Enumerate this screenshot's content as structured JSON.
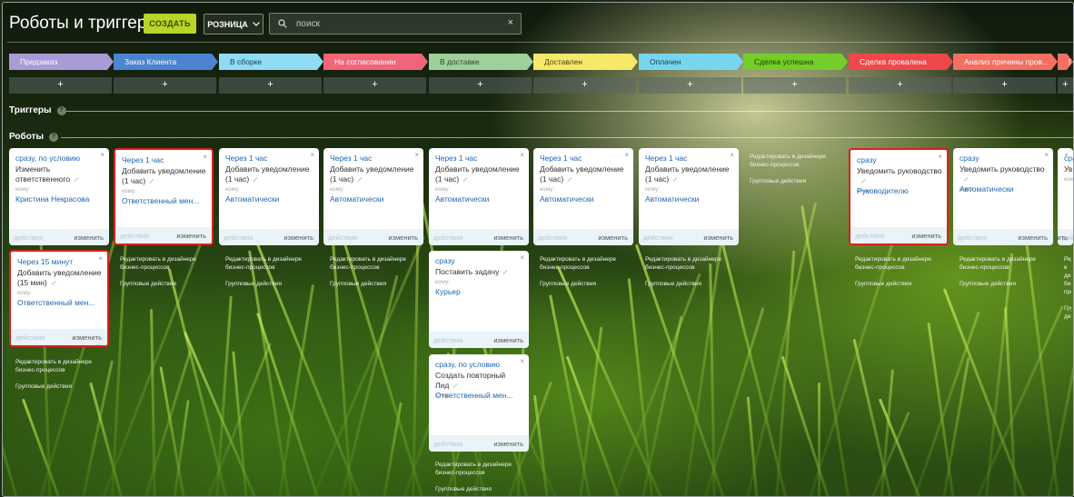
{
  "header": {
    "title": "Роботы и триггеры",
    "create_label": "СОЗДАТЬ",
    "funnel_label": "РОЗНИЦА",
    "search_placeholder": "поиск"
  },
  "stages": [
    {
      "name": "Предзаказ",
      "color": "#a99bd6",
      "text": "#ffffff"
    },
    {
      "name": "Заказ Клиента",
      "color": "#4c84d2",
      "text": "#ffffff"
    },
    {
      "name": "В сборке",
      "color": "#8fdcf4",
      "text": "#1d3c4a"
    },
    {
      "name": "На согласовании",
      "color": "#f0657a",
      "text": "#ffffff"
    },
    {
      "name": "В доставке",
      "color": "#9fcf9a",
      "text": "#2b4a2a"
    },
    {
      "name": "Доставлен",
      "color": "#f6e96a",
      "text": "#4a4410"
    },
    {
      "name": "Оплачен",
      "color": "#77d5f0",
      "text": "#1d3c4a"
    },
    {
      "name": "Сделка успешна",
      "color": "#74cd2a",
      "text": "#1f3a04"
    },
    {
      "name": "Сделка провалена",
      "color": "#f0474b",
      "text": "#ffffff"
    },
    {
      "name": "Анализ причины пров...",
      "color": "#f56e62",
      "text": "#ffffff"
    },
    {
      "name": "П",
      "color": "#f56e62",
      "text": "#ffffff"
    }
  ],
  "add_symbol": "+",
  "sections": {
    "triggers": "Триггеры",
    "robots": "Роботы",
    "help": "?"
  },
  "card_labels": {
    "to": "кому:",
    "actions": "действия",
    "edit": "изменить",
    "close": "×"
  },
  "links": {
    "edit_designer_1": "Редактировать в дизайнере",
    "edit_designer_2": "бизнес-процессов",
    "group_actions": "Групповые действия"
  },
  "cards": [
    {
      "delay": "сразу, по условию",
      "title": "Изменить ответственного",
      "who": "Кристина Некрасова",
      "highlight": false
    },
    {
      "delay": "Через 15 минут",
      "title": "Добавить уведомление (15 мин)",
      "who": "Ответственный мен...",
      "highlight": true
    },
    {
      "delay": "Через 1 час",
      "title": "Добавить уведомление (1 час)",
      "who": "Ответственный мен...",
      "highlight": true
    },
    {
      "delay": "Через 1 час",
      "title": "Добавить уведомление (1 час)",
      "who": "Автоматически",
      "highlight": false
    },
    {
      "delay": "Через 1 час",
      "title": "Добавить уведомление (1 час)",
      "who": "Автоматически",
      "highlight": false
    },
    {
      "delay": "Через 1 час",
      "title": "Добавить уведомление (1 час)",
      "who": "Автоматически",
      "highlight": false
    },
    {
      "delay": "сразу",
      "title": "Поставить задачу",
      "who": "Курьер",
      "highlight": false
    },
    {
      "delay": "сразу, по условию",
      "title": "Создать повторный Лид",
      "who": "Ответственный мен...",
      "highlight": false
    },
    {
      "delay": "Через 1 час",
      "title": "Добавить уведомление (1 час)",
      "who": "Автоматически",
      "highlight": false
    },
    {
      "delay": "Через 1 час",
      "title": "Добавить уведомление (1 час)",
      "who": "Автоматически",
      "highlight": false
    },
    {
      "delay": "сразу",
      "title": "Уведомить руководство",
      "who": "Руководителю",
      "highlight": true
    },
    {
      "delay": "сразу",
      "title": "Уведомить руководство",
      "who": "Автоматически",
      "highlight": false
    },
    {
      "delay": "сра",
      "title": "Ув",
      "who": "",
      "highlight": false
    }
  ],
  "colors": {
    "accent": "#b9d529",
    "link": "#1b67b3",
    "highlight": "#e01e1e"
  }
}
